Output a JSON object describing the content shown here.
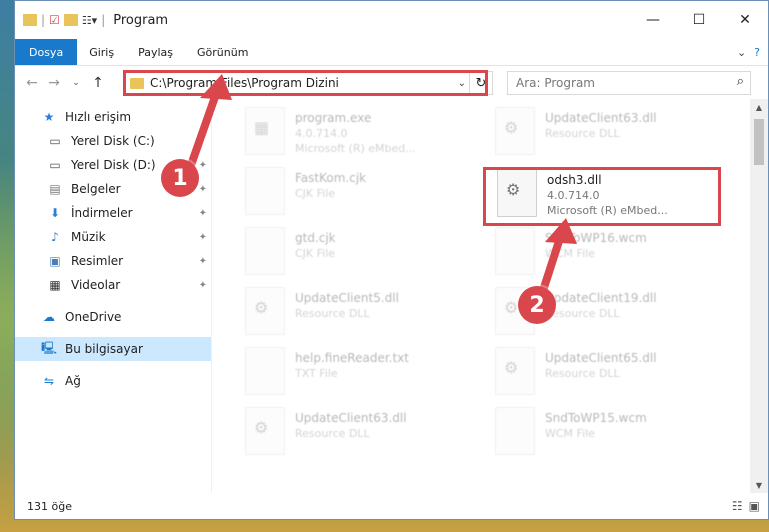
{
  "window": {
    "title": "Program"
  },
  "ribbon": {
    "tabs": [
      "Dosya",
      "Giriş",
      "Paylaş",
      "Görünüm"
    ]
  },
  "address": {
    "path": "C:\\Program Files\\Program Dizini"
  },
  "search": {
    "placeholder": "Ara: Program"
  },
  "sidebar": {
    "items": [
      {
        "label": "Hızlı erişim"
      },
      {
        "label": "Yerel Disk (C:)"
      },
      {
        "label": "Yerel Disk (D:)"
      },
      {
        "label": "Belgeler"
      },
      {
        "label": "İndirmeler"
      },
      {
        "label": "Müzik"
      },
      {
        "label": "Resimler"
      },
      {
        "label": "Videolar"
      },
      {
        "label": "OneDrive"
      },
      {
        "label": "Bu bilgisayar"
      },
      {
        "label": "Ağ"
      }
    ]
  },
  "files": {
    "items": [
      {
        "name": "program.exe",
        "sub": "4.0.714.0",
        "sub2": "Microsoft (R) eMbed..."
      },
      {
        "name": "UpdateClient63.dll",
        "sub": "Resource DLL"
      },
      {
        "name": "FastKom.cjk",
        "sub": "CJK File"
      },
      {
        "name": "odsh3.dll",
        "sub": "4.0.714.0",
        "sub2": "Microsoft (R) eMbed..."
      },
      {
        "name": "gtd.cjk",
        "sub": "CJK File"
      },
      {
        "name": "SndToWP16.wcm",
        "sub": "WCM File"
      },
      {
        "name": "UpdateClient5.dll",
        "sub": "Resource DLL"
      },
      {
        "name": "UpdateClient19.dll",
        "sub": "Resource DLL"
      },
      {
        "name": "help.fineReader.txt",
        "sub": "TXT File"
      },
      {
        "name": "UpdateClient65.dll",
        "sub": "Resource DLL"
      },
      {
        "name": "UpdateClient63.dll",
        "sub": "Resource DLL"
      },
      {
        "name": "SndToWP15.wcm",
        "sub": "WCM File"
      }
    ]
  },
  "status": {
    "count": "131 öğe"
  },
  "annotations": {
    "step1": "1",
    "step2": "2"
  },
  "colors": {
    "highlight": "#d9474c",
    "accent": "#1979ca",
    "selected": "#cce8ff"
  }
}
